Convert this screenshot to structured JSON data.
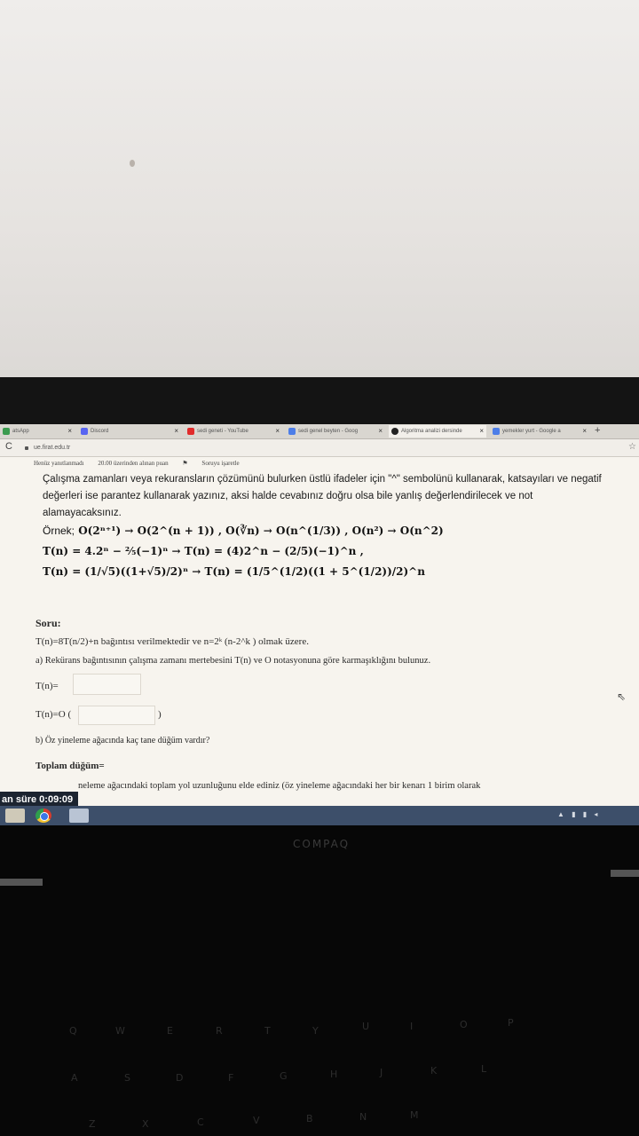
{
  "browser": {
    "tabs": [
      {
        "label": "atsApp",
        "color": "#3b9b4f"
      },
      {
        "label": "Discord",
        "color": "#5865f2"
      },
      {
        "label": "sedi geneti - YouTube",
        "color": "#e12b2b"
      },
      {
        "label": "sedi genel beyten - Goog",
        "color": "#4d7ee8"
      },
      {
        "label": "Algoritma analizi dersinde",
        "color": "#222222"
      },
      {
        "label": "yemekler yurt - Google a",
        "color": "#4d7ee8"
      }
    ],
    "new_tab": "+",
    "url": "ue.firat.edu.tr"
  },
  "quiz": {
    "status": "Henüz yanıtlanmadı",
    "points": "20.00 üzerinden alınan puan",
    "flag": "Soruyu işaretle",
    "instructions": "Çalışma zamanları veya rekuransların çözümünü bulurken üstlü ifadeler için \"^\" sembolünü kullanarak, katsayıları ve negatif değerleri ise parantez kullanarak yazınız, aksi halde cevabınız doğru olsa bile yanlış değerlendirilecek ve not alamayacaksınız.",
    "example_label": "Örnek;",
    "example_line1": "O(2ⁿ⁺¹) → O(2^(n + 1)) ,  O(∛n) → O(n^(1/3)) , O(n²) → O(n^2)",
    "example_line2": "T(n) = 4.2ⁿ − ⅖(−1)ⁿ → T(n) = (4)2^n − (2/5)(−1)^n ,",
    "example_line3": "T(n) = (1/√5)((1+√5)/2)ⁿ → T(n) = (1/5^(1/2)((1 + 5^(1/2))/2)^n",
    "question_title": "Soru:",
    "question_text": "T(n)=8T(n/2)+n  bağıntısı verilmektedir ve n=2ᵏ (n-2^k ) olmak üzere.",
    "part_a": "a) Rekürans bağıntısının çalışma zamanı mertebesini T(n) ve O notasyonuna göre karmaşıklığını bulunuz.",
    "tn_label": "T(n)=",
    "tn_o_label": "T(n)=O (",
    "tn_o_close": ")",
    "part_b": "b) Öz yineleme ağacında kaç tane düğüm vardır?",
    "total_nodes": "Toplam düğüm=",
    "part_c": "neleme ağacındaki toplam yol uzunluğunu elde ediniz (öz yineleme ağacındaki her bir kenarı 1 birim olarak"
  },
  "timer": "an süre 0:09:09",
  "laptop_brand": "COMPAQ",
  "keys": [
    "Q",
    "W",
    "E",
    "R",
    "T",
    "Y",
    "U",
    "I",
    "O",
    "P",
    "A",
    "S",
    "D",
    "F",
    "G",
    "H",
    "J",
    "K",
    "L",
    "Z",
    "X",
    "C",
    "V",
    "B",
    "N",
    "M"
  ]
}
